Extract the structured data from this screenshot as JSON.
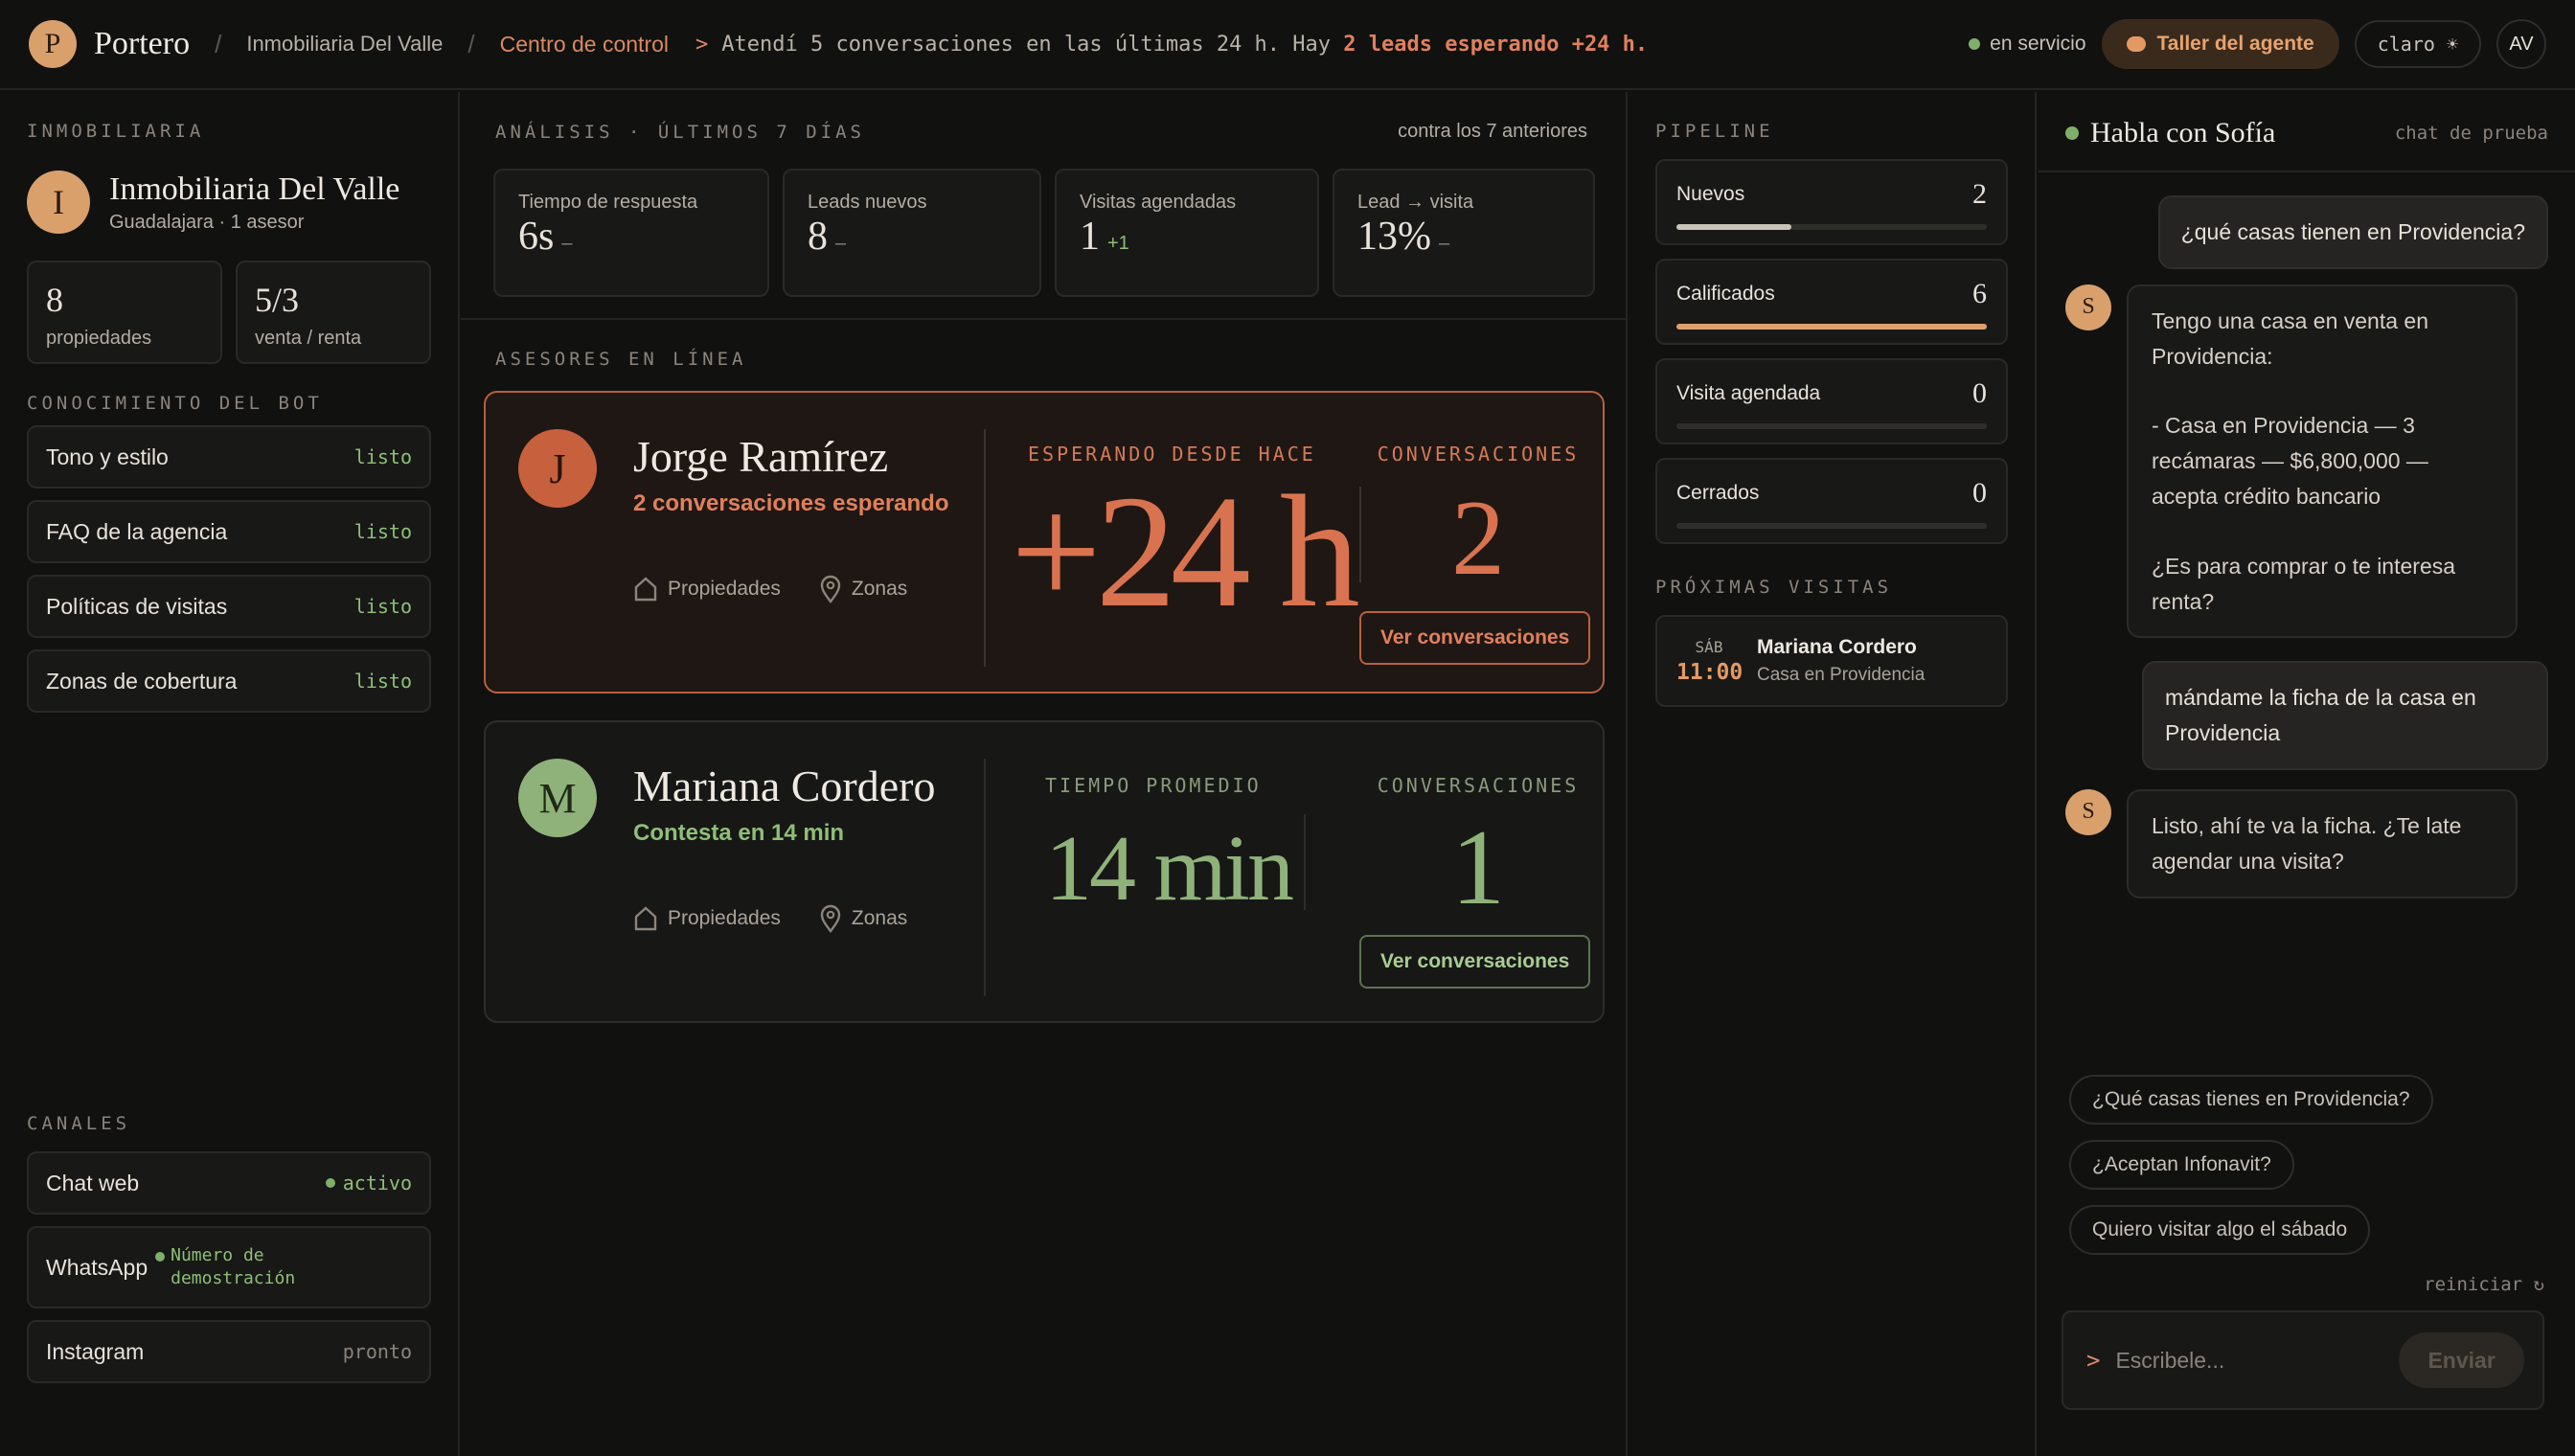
{
  "topbar": {
    "logo_letter": "P",
    "brand": "Portero",
    "crumb1": "Inmobiliaria Del Valle",
    "crumb2": "Centro de control",
    "ticker_prefix": ">",
    "ticker_text": "Atendí 5 conversaciones en las últimas 24 h. Hay",
    "ticker_highlight": "2 leads esperando +24 h.",
    "status": "en servicio",
    "taller": "Taller del agente",
    "theme": "claro ☀",
    "user_initials": "AV"
  },
  "left": {
    "section_label": "INMOBILIARIA",
    "agency_letter": "I",
    "agency_name": "Inmobiliaria Del Valle",
    "agency_sub": "Guadalajara · 1 asesor",
    "stats": [
      {
        "value": "8",
        "label": "propiedades"
      },
      {
        "value": "5/3",
        "label": "venta / renta"
      }
    ],
    "knowledge_label": "CONOCIMIENTO DEL BOT",
    "knowledge": [
      {
        "label": "Tono y estilo",
        "status": "listo"
      },
      {
        "label": "FAQ de la agencia",
        "status": "listo"
      },
      {
        "label": "Políticas de visitas",
        "status": "listo"
      },
      {
        "label": "Zonas de cobertura",
        "status": "listo"
      }
    ],
    "channels_label": "CANALES",
    "channels": [
      {
        "label": "Chat web",
        "status": "activo"
      },
      {
        "label": "WhatsApp",
        "status": "Número de demostración"
      },
      {
        "label": "Instagram",
        "status": "pronto"
      }
    ]
  },
  "analytics": {
    "label": "ANÁLISIS · ÚLTIMOS 7 DÍAS",
    "compare": "contra los 7 anteriores",
    "kpis": [
      {
        "title": "Tiempo de respuesta",
        "value": "6s",
        "delta": "–"
      },
      {
        "title": "Leads nuevos",
        "value": "8",
        "delta": "–"
      },
      {
        "title": "Visitas agendadas",
        "value": "1",
        "delta": "+1"
      },
      {
        "title": "Lead → visita",
        "value": "13%",
        "delta": "–"
      }
    ]
  },
  "advisors": {
    "label": "ASESORES EN LÍNEA",
    "list": [
      {
        "letter": "J",
        "name": "Jorge Ramírez",
        "status": "2 conversaciones esperando",
        "prop": "Propiedades",
        "zones": "Zonas",
        "metric_label": "ESPERANDO DESDE HACE",
        "metric": "+24 h",
        "conv_label": "CONVERSACIONES",
        "conv": "2",
        "button": "Ver conversaciones"
      },
      {
        "letter": "M",
        "name": "Mariana Cordero",
        "status": "Contesta en 14 min",
        "prop": "Propiedades",
        "zones": "Zonas",
        "metric_label": "TIEMPO PROMEDIO",
        "metric": "14 min",
        "conv_label": "CONVERSACIONES",
        "conv": "1",
        "button": "Ver conversaciones"
      }
    ]
  },
  "pipeline": {
    "label": "PIPELINE",
    "stages": [
      {
        "name": "Nuevos",
        "count": "2",
        "fraction": 0.37
      },
      {
        "name": "Calificados",
        "count": "6",
        "fraction": 1.0
      },
      {
        "name": "Visita agendada",
        "count": "0",
        "fraction": 0
      },
      {
        "name": "Cerrados",
        "count": "0",
        "fraction": 0
      }
    ],
    "visits_label": "PRÓXIMAS VISITAS",
    "visit": {
      "day": "SÁB",
      "time": "11:00",
      "name": "Mariana Cordero",
      "place": "Casa en Providencia"
    }
  },
  "chat": {
    "title": "Habla con Sofía",
    "subtitle": "chat de prueba",
    "bot_letter": "S",
    "msg1": "¿qué casas tienen en Providencia?",
    "msg2_a": "Tengo una casa en venta en Providencia:",
    "msg2_b": "- Casa en Providencia — 3 recámaras — $6,800,000 — acepta crédito bancario",
    "msg2_c": "¿Es para comprar o te interesa renta?",
    "msg3": "mándame la ficha de la casa en Providencia",
    "msg4": "Listo, ahí te va la ficha. ¿Te late agendar una visita?",
    "suggestions": [
      "¿Qué casas tienes en Providencia?",
      "¿Aceptan Infonavit?",
      "Quiero visitar algo el sábado"
    ],
    "reset": "reiniciar ↻",
    "prompt": ">",
    "placeholder": "Escribele...",
    "send": "Enviar"
  }
}
